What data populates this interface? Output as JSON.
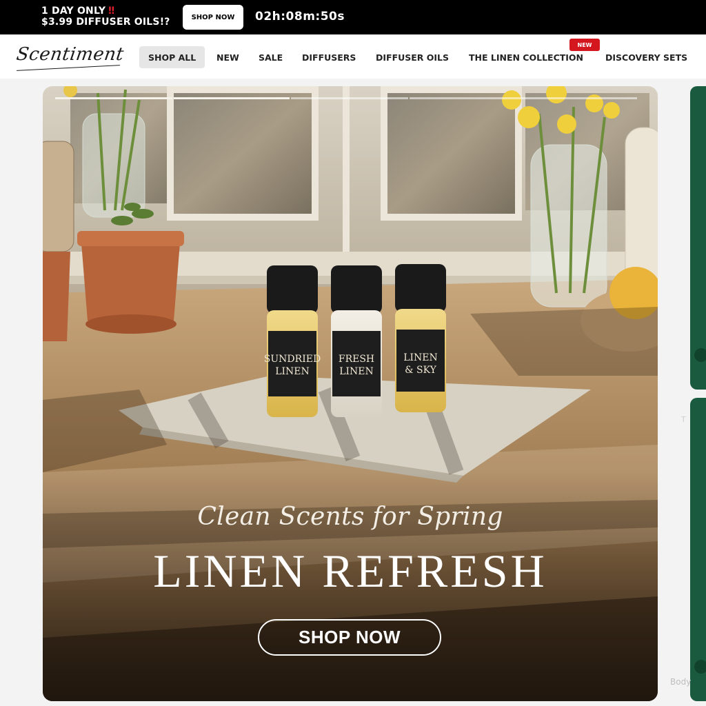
{
  "promo": {
    "line1": "1 DAY ONLY",
    "alert": "‼",
    "line2": "$3.99 DIFFUSER OILS!?",
    "button": "SHOP NOW",
    "countdown": "02h:08m:50s"
  },
  "nav": {
    "logo": "Scentiment",
    "items": [
      "SHOP ALL",
      "NEW",
      "SALE",
      "DIFFUSERS",
      "DIFFUSER OILS",
      "THE LINEN COLLECTION",
      "DISCOVERY SETS"
    ],
    "badge": "NEW"
  },
  "hero": {
    "tagline": "Clean Scents for Spring",
    "headline": "LINEN REFRESH",
    "cta": "SHOP NOW",
    "bottles": [
      {
        "line1": "SUNDRIED",
        "line2": "LINEN"
      },
      {
        "line1": "FRESH",
        "line2": "LINEN"
      },
      {
        "line1": "LINEN",
        "line2": "& SKY"
      }
    ]
  },
  "side": {
    "text1": "T",
    "text2": "Body"
  },
  "colors": {
    "promo_bg": "#000000",
    "badge": "#d4161f",
    "peek_green": "#1a5b3f"
  }
}
